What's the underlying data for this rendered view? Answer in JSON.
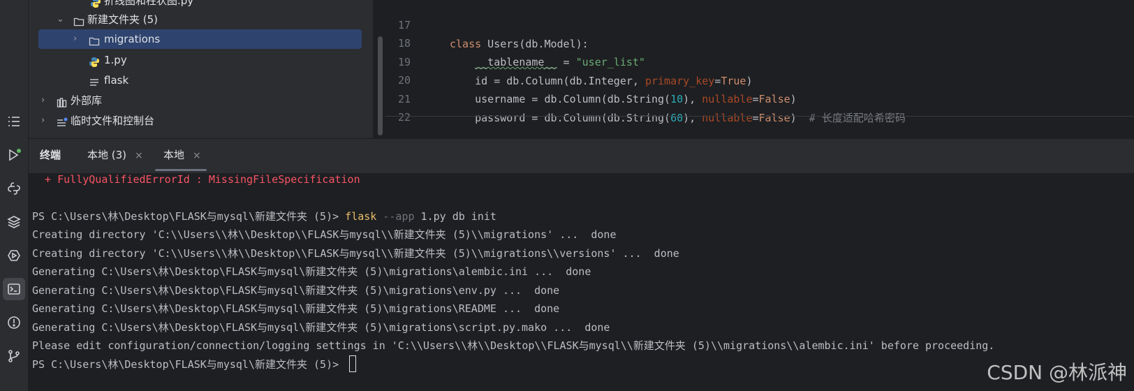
{
  "project_tree": {
    "items": [
      {
        "label": "折线图和柱状图.py",
        "icon": "python-file-icon"
      },
      {
        "label": "新建文件夹 (5)",
        "icon": "folder-icon",
        "chevron": "⌄"
      },
      {
        "label": "migrations",
        "icon": "folder-icon",
        "chevron": "›"
      },
      {
        "label": "1.py",
        "icon": "python-file-icon"
      },
      {
        "label": "flask",
        "icon": "text-file-icon"
      },
      {
        "label": "外部库",
        "icon": "library-icon",
        "chevron": "›"
      },
      {
        "label": "临时文件和控制台",
        "icon": "scratches-icon",
        "chevron": "›"
      }
    ]
  },
  "editor": {
    "lines": [
      {
        "num": "17"
      },
      {
        "num": "18"
      },
      {
        "num": "19"
      },
      {
        "num": "20"
      },
      {
        "num": "21"
      },
      {
        "num": "22"
      }
    ],
    "tokens": {
      "l17_kw": "class",
      "l17_rest": " Users(db.Model):",
      "l18_a": "    ",
      "l18_name": "__tablename__",
      "l18_eq": " = ",
      "l18_str": "\"user_list\"",
      "l19_a": "    id = db.Column(db.Integer, ",
      "l19_param": "primary_key",
      "l19_eq": "=",
      "l19_val": "True",
      "l19_end": ")",
      "l20_a": "    username = db.Column(db.String(",
      "l20_num": "10",
      "l20_b": "), ",
      "l20_param": "nullable",
      "l20_eq": "=",
      "l20_val": "False",
      "l20_end": ")",
      "l21_a": "    password = db.Column(db.String(",
      "l21_num": "60",
      "l21_b": "), ",
      "l21_param": "nullable",
      "l21_eq": "=",
      "l21_val": "False",
      "l21_end": ")  ",
      "l21_cmt": "# 长度适配哈希密码"
    }
  },
  "terminal": {
    "panel_title": "终端",
    "tabs": [
      {
        "label": "本地 (3)",
        "close": "×"
      },
      {
        "label": "本地",
        "close": "×"
      }
    ],
    "error_line": "  + FullyQualifiedErrorId : MissingFileSpecification",
    "prompt": "PS C:\\Users\\林\\Desktop\\FLASK与mysql\\新建文件夹 (5)> ",
    "cmd_flask": "flask",
    "cmd_opt": " --app",
    "cmd_rest": " 1.py db init",
    "output": [
      "Creating directory 'C:\\\\Users\\\\林\\\\Desktop\\\\FLASK与mysql\\\\新建文件夹 (5)\\\\migrations' ...  done",
      "Creating directory 'C:\\\\Users\\\\林\\\\Desktop\\\\FLASK与mysql\\\\新建文件夹 (5)\\\\migrations\\\\versions' ...  done",
      "Generating C:\\Users\\林\\Desktop\\FLASK与mysql\\新建文件夹 (5)\\migrations\\alembic.ini ...  done",
      "Generating C:\\Users\\林\\Desktop\\FLASK与mysql\\新建文件夹 (5)\\migrations\\env.py ...  done",
      "Generating C:\\Users\\林\\Desktop\\FLASK与mysql\\新建文件夹 (5)\\migrations\\README ...  done",
      "Generating C:\\Users\\林\\Desktop\\FLASK与mysql\\新建文件夹 (5)\\migrations\\script.py.mako ...  done",
      "Please edit configuration/connection/logging settings in 'C:\\\\Users\\\\林\\\\Desktop\\\\FLASK与mysql\\\\新建文件夹 (5)\\\\migrations\\\\alembic.ini' before proceeding."
    ],
    "final_prompt": "PS C:\\Users\\林\\Desktop\\FLASK与mysql\\新建文件夹 (5)> "
  },
  "watermark": "CSDN @林派神",
  "activity_icons": [
    "structure-icon",
    "run-icon",
    "python-console-icon",
    "layers-icon",
    "services-icon",
    "terminal-icon",
    "problems-icon",
    "git-icon"
  ],
  "colors": {
    "background": "#1e1f22",
    "panel": "#2b2d30",
    "selection": "#2e436e",
    "keyword": "#cf8e6d",
    "string": "#6aab73",
    "number": "#2aacb8",
    "param": "#aa4926",
    "error": "#f75464",
    "command": "#e8bf6a"
  }
}
